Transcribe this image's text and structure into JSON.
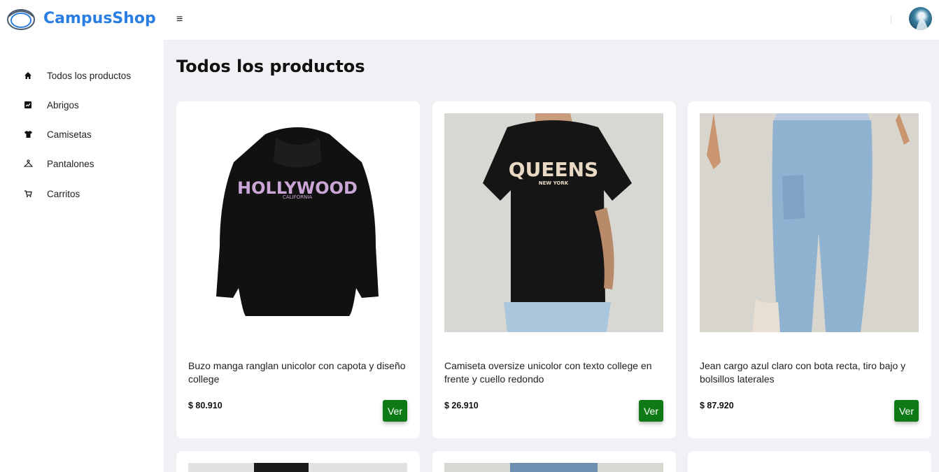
{
  "header": {
    "brand": "CampusShop",
    "menu_icon": "hamburger-menu-icon",
    "accent_color": "#2a7de1"
  },
  "sidebar": {
    "items": [
      {
        "label": "Todos los productos",
        "icon": "home-icon"
      },
      {
        "label": "Abrigos",
        "icon": "chart-icon"
      },
      {
        "label": "Camisetas",
        "icon": "tshirt-icon"
      },
      {
        "label": "Pantalones",
        "icon": "hanger-icon"
      },
      {
        "label": "Carritos",
        "icon": "cart-icon"
      }
    ]
  },
  "main": {
    "title": "Todos los productos",
    "products": [
      {
        "name": "Buzo manga ranglan unicolor con capota y diseño college",
        "price": "$ 80.910",
        "button": "Ver",
        "image_text": "HOLLYWOOD",
        "image_subtext": "CALIFORNIA"
      },
      {
        "name": "Camiseta oversize unicolor con texto college en frente y cuello redondo",
        "price": "$ 26.910",
        "button": "Ver",
        "image_text": "QUEENS",
        "image_subtext": "NEW YORK"
      },
      {
        "name": "Jean cargo azul claro con bota recta, tiro bajo y bolsillos laterales",
        "price": "$ 87.920",
        "button": "Ver"
      }
    ],
    "button_color": "#0d7a15"
  }
}
